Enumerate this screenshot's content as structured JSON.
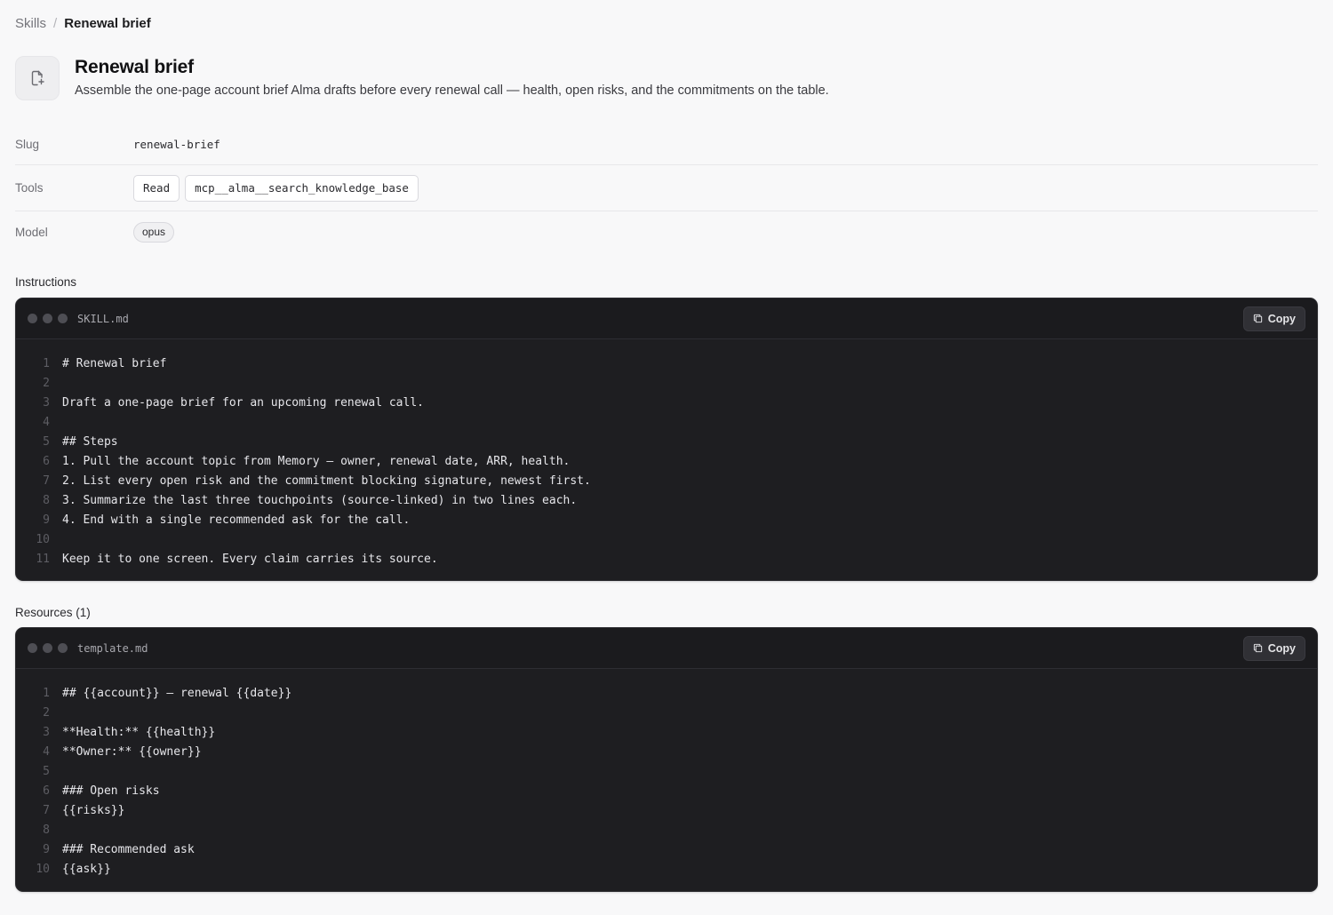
{
  "breadcrumb": {
    "root": "Skills",
    "separator": "/",
    "current": "Renewal brief"
  },
  "header": {
    "icon": "file-sparkle-icon",
    "title": "Renewal brief",
    "description": "Assemble the one-page account brief Alma drafts before every renewal call — health, open risks, and the commitments on the table."
  },
  "meta": {
    "slug_label": "Slug",
    "slug_value": "renewal-brief",
    "tools_label": "Tools",
    "tools": [
      "Read",
      "mcp__alma__search_knowledge_base"
    ],
    "model_label": "Model",
    "model_value": "opus"
  },
  "instructions": {
    "section_title": "Instructions",
    "file_name": "SKILL.md",
    "copy_label": "Copy",
    "lines": [
      {
        "n": "1",
        "text": "# Renewal brief"
      },
      {
        "n": "2",
        "text": ""
      },
      {
        "n": "3",
        "text": "Draft a one-page brief for an upcoming renewal call."
      },
      {
        "n": "4",
        "text": ""
      },
      {
        "n": "5",
        "text": "## Steps"
      },
      {
        "n": "6",
        "text": "1. Pull the account topic from Memory — owner, renewal date, ARR, health."
      },
      {
        "n": "7",
        "text": "2. List every open risk and the commitment blocking signature, newest first."
      },
      {
        "n": "8",
        "text": "3. Summarize the last three touchpoints (source-linked) in two lines each."
      },
      {
        "n": "9",
        "text": "4. End with a single recommended ask for the call."
      },
      {
        "n": "10",
        "text": ""
      },
      {
        "n": "11",
        "text": "Keep it to one screen. Every claim carries its source."
      }
    ]
  },
  "resources": {
    "section_title": "Resources (1)",
    "file_name": "template.md",
    "copy_label": "Copy",
    "lines": [
      {
        "n": "1",
        "text": "## {{account}} — renewal {{date}}"
      },
      {
        "n": "2",
        "text": ""
      },
      {
        "n": "3",
        "text": "**Health:** {{health}}"
      },
      {
        "n": "4",
        "text": "**Owner:** {{owner}}"
      },
      {
        "n": "5",
        "text": ""
      },
      {
        "n": "6",
        "text": "### Open risks"
      },
      {
        "n": "7",
        "text": "{{risks}}"
      },
      {
        "n": "8",
        "text": ""
      },
      {
        "n": "9",
        "text": "### Recommended ask"
      },
      {
        "n": "10",
        "text": "{{ask}}"
      }
    ]
  },
  "colors": {
    "page_bg": "#f8f8f9",
    "code_bg": "#1e1e21",
    "code_text": "#e6e6ea",
    "line_number": "#5d5d63"
  }
}
